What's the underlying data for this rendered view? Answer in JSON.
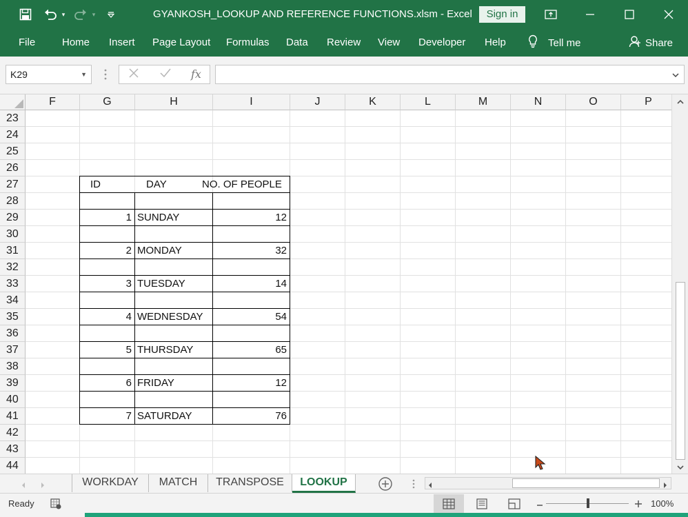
{
  "titlebar": {
    "title": "GYANKOSH_LOOKUP AND REFERENCE FUNCTIONS.xlsm  -  Excel",
    "sign_in": "Sign in",
    "icons": [
      "save-icon",
      "undo-icon",
      "redo-icon",
      "customize-qat-icon",
      "ribbon-display-icon",
      "minimize-icon",
      "restore-icon",
      "close-icon"
    ]
  },
  "ribbon": {
    "tabs": [
      "File",
      "Home",
      "Insert",
      "Page Layout",
      "Formulas",
      "Data",
      "Review",
      "View",
      "Developer",
      "Help"
    ],
    "tell_me": "Tell me",
    "share": "Share"
  },
  "formula_bar": {
    "name_box": "K29",
    "fx": "fx",
    "formula": ""
  },
  "columns": [
    "F",
    "G",
    "H",
    "I",
    "J",
    "K",
    "L",
    "M",
    "N",
    "O",
    "P"
  ],
  "rows": [
    "23",
    "24",
    "25",
    "26",
    "27",
    "28",
    "29",
    "30",
    "31",
    "32",
    "33",
    "34",
    "35",
    "36",
    "37",
    "38",
    "39",
    "40",
    "41",
    "42",
    "43",
    "44"
  ],
  "table": {
    "headers": [
      "ID",
      "DAY",
      "NO. OF PEOPLE"
    ],
    "records": [
      {
        "id": "1",
        "day": "SUNDAY",
        "people": "12"
      },
      {
        "id": "2",
        "day": "MONDAY",
        "people": "32"
      },
      {
        "id": "3",
        "day": "TUESDAY",
        "people": "14"
      },
      {
        "id": "4",
        "day": "WEDNESDAY",
        "people": "54"
      },
      {
        "id": "5",
        "day": "THURSDAY",
        "people": "65"
      },
      {
        "id": "6",
        "day": "FRIDAY",
        "people": "12"
      },
      {
        "id": "7",
        "day": "SATURDAY",
        "people": "76"
      }
    ]
  },
  "sheets": [
    "WORKDAY",
    "MATCH",
    "TRANSPOSE",
    "LOOKUP"
  ],
  "active_sheet": "LOOKUP",
  "status": {
    "ready": "Ready",
    "zoom": "100%"
  },
  "colors": {
    "excel_green": "#217346",
    "grid_line": "#e1e1e1"
  }
}
